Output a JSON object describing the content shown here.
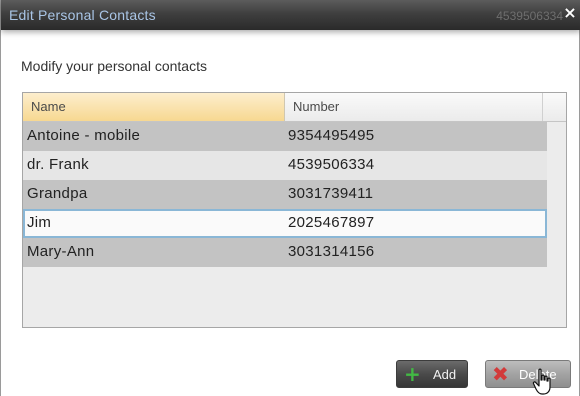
{
  "dialog": {
    "title": "Edit Personal Contacts",
    "title_ghost_text": "4539506334",
    "close_glyph": "×",
    "prompt": "Modify your personal contacts"
  },
  "grid": {
    "columns": [
      "Name",
      "Number"
    ],
    "rows": [
      {
        "name": "Antoine - mobile",
        "number": "9354495495"
      },
      {
        "name": "dr. Frank",
        "number": "4539506334"
      },
      {
        "name": "Grandpa",
        "number": "3031739411"
      },
      {
        "name": "Jim",
        "number": "2025467897"
      },
      {
        "name": "Mary-Ann",
        "number": "3031314156"
      }
    ],
    "selected_row_index": 3
  },
  "buttons": {
    "add_label": "Add",
    "add_icon": "plus-icon",
    "delete_label": "Delete",
    "delete_icon": "x-mark-icon"
  },
  "colors": {
    "title_text": "#a9c5e6",
    "header_sorted": "#f7d891",
    "selection_border": "#8ab7d6",
    "add_icon": "#42b944",
    "delete_icon": "#d23a3a"
  }
}
